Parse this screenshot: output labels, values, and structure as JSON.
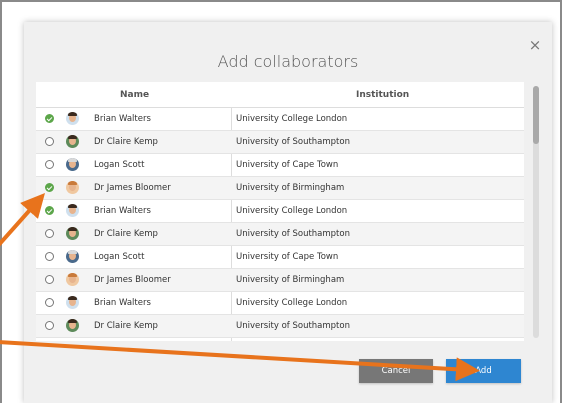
{
  "dialog": {
    "title": "Add collaborators",
    "close_label": "×",
    "columns": {
      "name": "Name",
      "institution": "Institution"
    },
    "rows": [
      {
        "selected": true,
        "name": "Brian Walters",
        "institution": "University College London",
        "avatar": "avatar-brian"
      },
      {
        "selected": false,
        "name": "Dr Claire Kemp",
        "institution": "University of Southampton",
        "avatar": "avatar-claire"
      },
      {
        "selected": false,
        "name": "Logan Scott",
        "institution": "University of Cape Town",
        "avatar": "avatar-logan"
      },
      {
        "selected": true,
        "name": "Dr James Bloomer",
        "institution": "University of Birmingham",
        "avatar": "avatar-james"
      },
      {
        "selected": true,
        "name": "Brian Walters",
        "institution": "University College London",
        "avatar": "avatar-brian"
      },
      {
        "selected": false,
        "name": "Dr Claire Kemp",
        "institution": "University of Southampton",
        "avatar": "avatar-claire"
      },
      {
        "selected": false,
        "name": "Logan Scott",
        "institution": "University of Cape Town",
        "avatar": "avatar-logan"
      },
      {
        "selected": false,
        "name": "Dr James Bloomer",
        "institution": "University of Birmingham",
        "avatar": "avatar-james"
      },
      {
        "selected": false,
        "name": "Brian Walters",
        "institution": "University College London",
        "avatar": "avatar-brian"
      },
      {
        "selected": false,
        "name": "Dr Claire Kemp",
        "institution": "University of Southampton",
        "avatar": "avatar-claire"
      }
    ],
    "buttons": {
      "cancel": "Cancel",
      "add": "Add"
    }
  },
  "colors": {
    "checked": "#5ca64a",
    "primary_button": "#2e86d1",
    "cancel_button": "#777777",
    "annotation_arrow": "#e8731c"
  }
}
